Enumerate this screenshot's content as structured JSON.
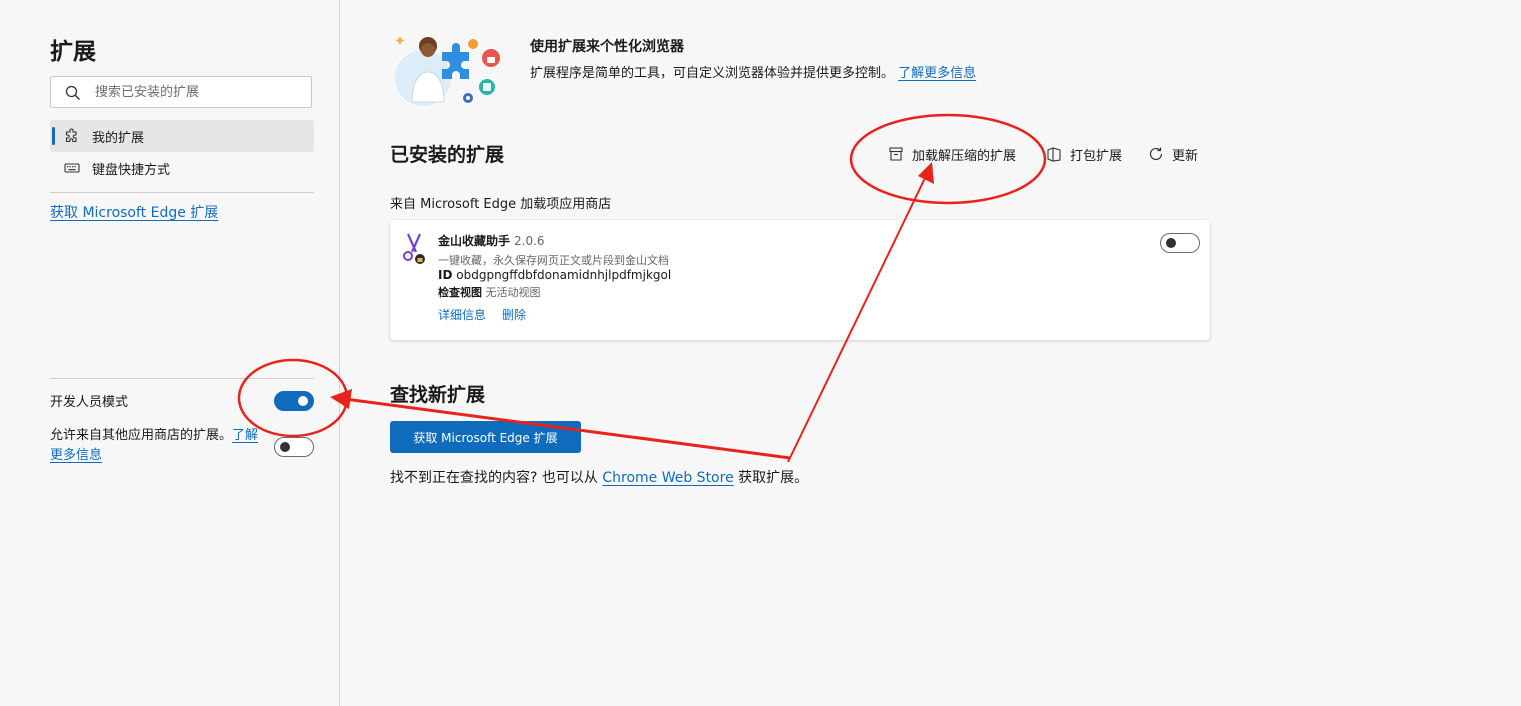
{
  "sidebar": {
    "title": "扩展",
    "search_placeholder": "搜索已安装的扩展",
    "nav": [
      {
        "label": "我的扩展",
        "active": true,
        "icon": "puzzle-icon"
      },
      {
        "label": "键盘快捷方式",
        "active": false,
        "icon": "keyboard-icon"
      }
    ],
    "get_extensions_link": "获取 Microsoft Edge 扩展",
    "developer_mode_label": "开发人员模式",
    "developer_mode_on": true,
    "allow_other_stores_text": "允许来自其他应用商店的扩展。",
    "allow_other_stores_link": "了解更多信息",
    "allow_other_stores_on": false
  },
  "hero": {
    "title": "使用扩展来个性化浏览器",
    "description": "扩展程序是简单的工具，可自定义浏览器体验并提供更多控制。",
    "learn_more": "了解更多信息"
  },
  "installed": {
    "title": "已安装的扩展",
    "actions": [
      {
        "label": "加载解压缩的扩展",
        "icon": "box-icon"
      },
      {
        "label": "打包扩展",
        "icon": "package-icon"
      },
      {
        "label": "更新",
        "icon": "refresh-icon"
      }
    ],
    "source_label": "来自 Microsoft Edge 加载项应用商店",
    "extension": {
      "name": "金山收藏助手",
      "version": "2.0.6",
      "description": "一键收藏，永久保存网页正文或片段到金山文档",
      "id_label": "ID",
      "id": "obdgpngffdbfdonamidnhjlpdfmjkgol",
      "inspect_label": "检查视图",
      "inspect_value": "无活动视图",
      "details_link": "详细信息",
      "remove_link": "删除",
      "enabled": false
    }
  },
  "find": {
    "title": "查找新扩展",
    "button": "获取 Microsoft Edge 扩展",
    "text_before": "找不到正在查找的内容? 也可以从",
    "chrome_store_link": "Chrome Web Store",
    "text_after": "获取扩展。"
  },
  "colors": {
    "accent": "#0f6cbd",
    "annotation": "#e8231b",
    "background": "#f7f7f7"
  }
}
